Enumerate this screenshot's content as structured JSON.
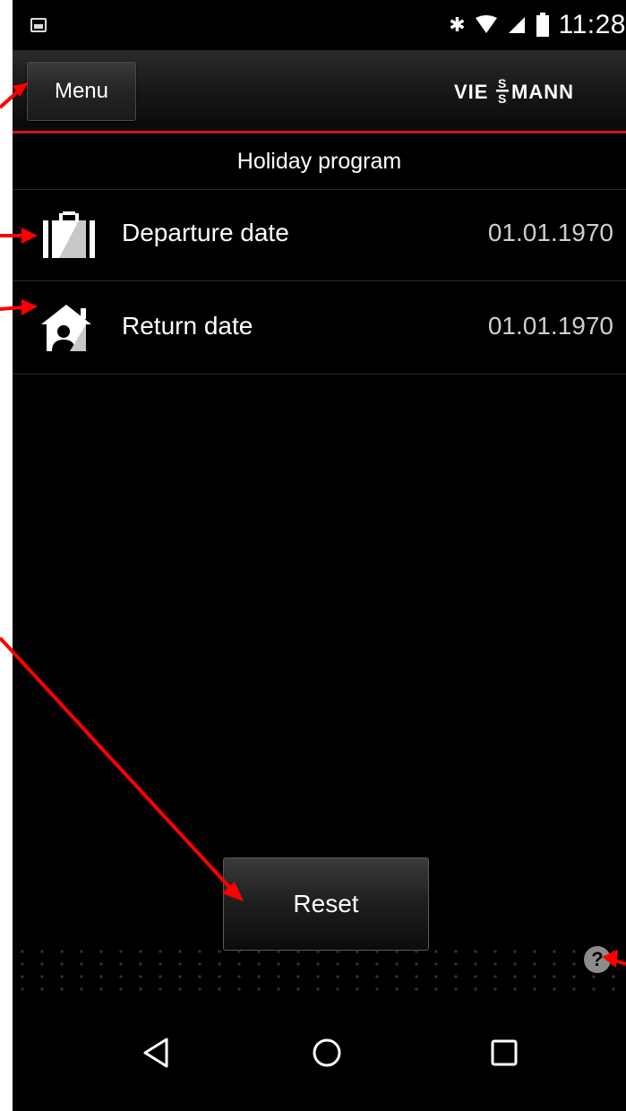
{
  "status_bar": {
    "time": "11:28",
    "icons": [
      "image-icon",
      "bluetooth-icon",
      "wifi-icon",
      "signal-icon",
      "battery-icon"
    ]
  },
  "app_bar": {
    "menu_label": "Menu",
    "brand": "VIESSMANN",
    "accent_color": "#d4141b"
  },
  "page": {
    "title": "Holiday program"
  },
  "rows": [
    {
      "label": "Departure date",
      "value": "01.01.1970",
      "icon": "suitcase-icon"
    },
    {
      "label": "Return date",
      "value": "01.01.1970",
      "icon": "home-person-icon"
    }
  ],
  "actions": {
    "reset_label": "Reset",
    "help_symbol": "?"
  },
  "nav_bar": {
    "buttons": [
      "back-icon",
      "home-icon",
      "recent-apps-icon"
    ]
  },
  "annotation_color": "#ff0000"
}
